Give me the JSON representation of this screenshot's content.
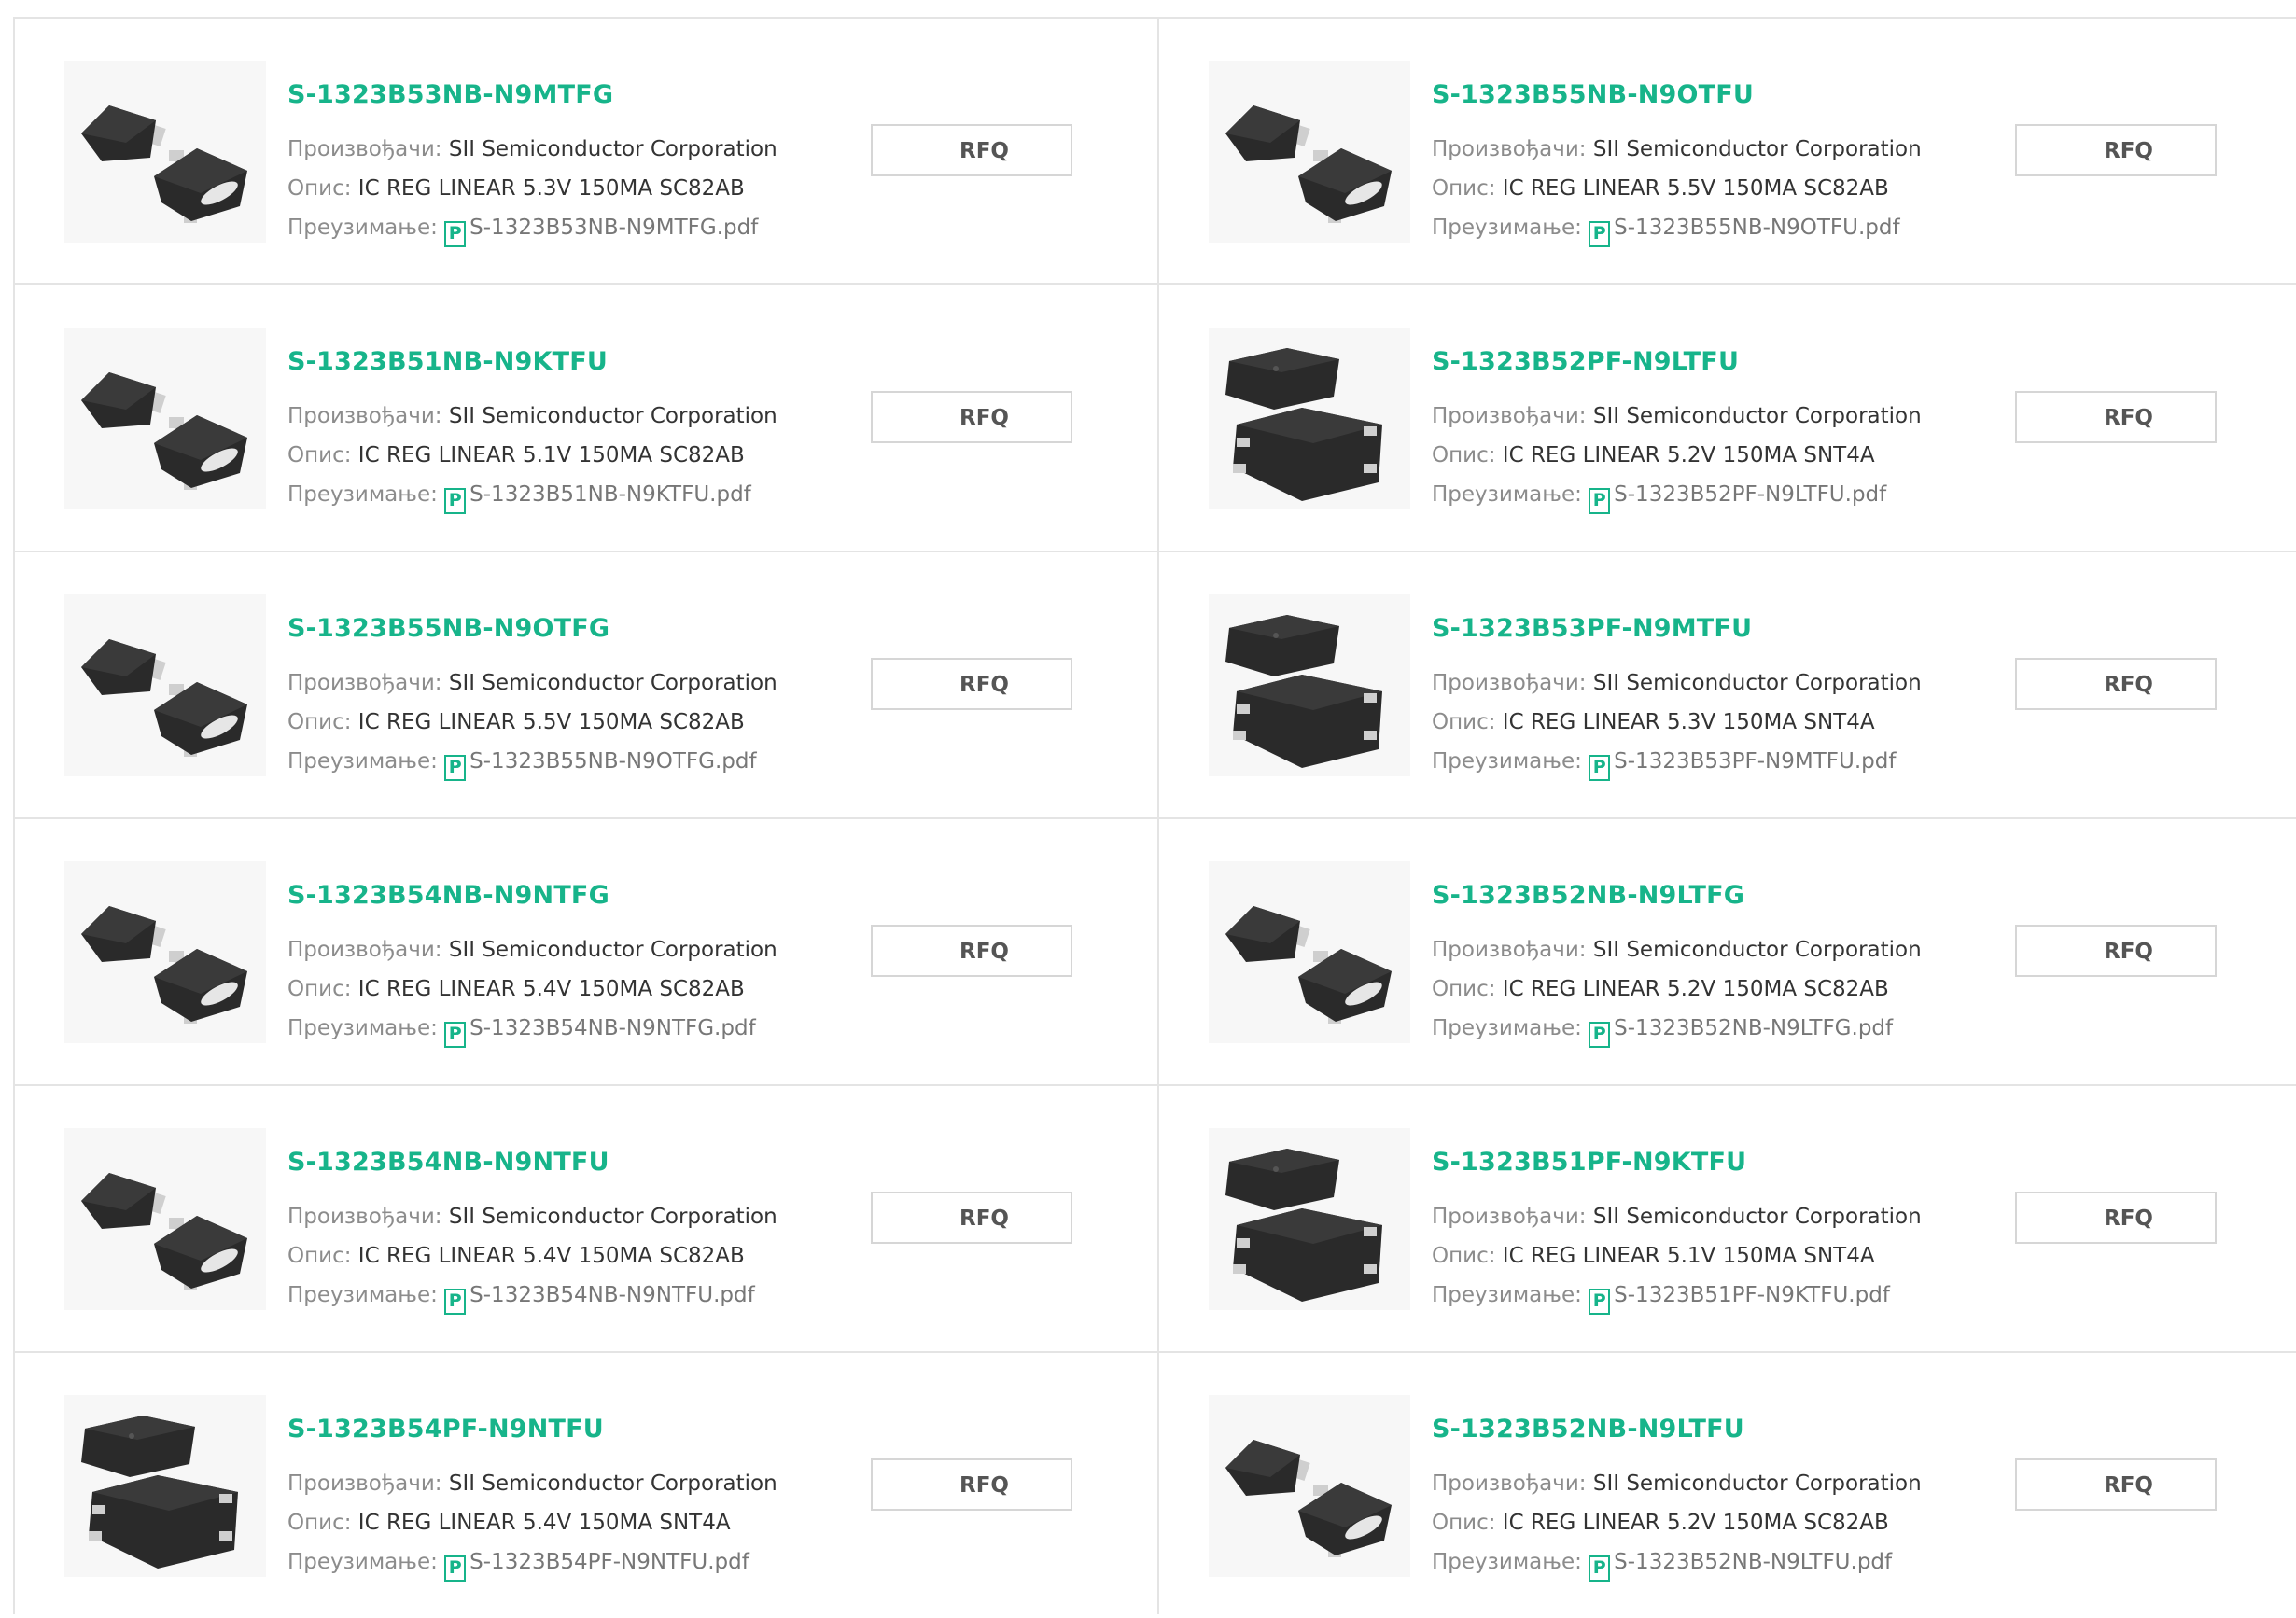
{
  "labels": {
    "manufacturer": "Произвођачи:",
    "description": "Опис:",
    "download": "Преузимање:",
    "rfq": "RFQ",
    "pdf_icon": "P"
  },
  "colors": {
    "accent": "#17b48a",
    "border": "#e4e4e4",
    "chip": "#2a2a2a",
    "pad": "#cfcfcf"
  },
  "products": [
    {
      "name": "S-1323B53NB-N9MTFG",
      "manufacturer": "SII Semiconductor Corporation",
      "description": "IC REG LINEAR 5.3V 150MA SC82AB",
      "pdf": "S-1323B53NB-N9MTFG.pdf",
      "package": "sc82ab"
    },
    {
      "name": "S-1323B55NB-N9OTFU",
      "manufacturer": "SII Semiconductor Corporation",
      "description": "IC REG LINEAR 5.5V 150MA SC82AB",
      "pdf": "S-1323B55NB-N9OTFU.pdf",
      "package": "sc82ab"
    },
    {
      "name": "S-1323B51NB-N9KTFU",
      "manufacturer": "SII Semiconductor Corporation",
      "description": "IC REG LINEAR 5.1V 150MA SC82AB",
      "pdf": "S-1323B51NB-N9KTFU.pdf",
      "package": "sc82ab"
    },
    {
      "name": "S-1323B52PF-N9LTFU",
      "manufacturer": "SII Semiconductor Corporation",
      "description": "IC REG LINEAR 5.2V 150MA SNT4A",
      "pdf": "S-1323B52PF-N9LTFU.pdf",
      "package": "snt4a"
    },
    {
      "name": "S-1323B55NB-N9OTFG",
      "manufacturer": "SII Semiconductor Corporation",
      "description": "IC REG LINEAR 5.5V 150MA SC82AB",
      "pdf": "S-1323B55NB-N9OTFG.pdf",
      "package": "sc82ab"
    },
    {
      "name": "S-1323B53PF-N9MTFU",
      "manufacturer": "SII Semiconductor Corporation",
      "description": "IC REG LINEAR 5.3V 150MA SNT4A",
      "pdf": "S-1323B53PF-N9MTFU.pdf",
      "package": "snt4a"
    },
    {
      "name": "S-1323B54NB-N9NTFG",
      "manufacturer": "SII Semiconductor Corporation",
      "description": "IC REG LINEAR 5.4V 150MA SC82AB",
      "pdf": "S-1323B54NB-N9NTFG.pdf",
      "package": "sc82ab"
    },
    {
      "name": "S-1323B52NB-N9LTFG",
      "manufacturer": "SII Semiconductor Corporation",
      "description": "IC REG LINEAR 5.2V 150MA SC82AB",
      "pdf": "S-1323B52NB-N9LTFG.pdf",
      "package": "sc82ab"
    },
    {
      "name": "S-1323B54NB-N9NTFU",
      "manufacturer": "SII Semiconductor Corporation",
      "description": "IC REG LINEAR 5.4V 150MA SC82AB",
      "pdf": "S-1323B54NB-N9NTFU.pdf",
      "package": "sc82ab"
    },
    {
      "name": "S-1323B51PF-N9KTFU",
      "manufacturer": "SII Semiconductor Corporation",
      "description": "IC REG LINEAR 5.1V 150MA SNT4A",
      "pdf": "S-1323B51PF-N9KTFU.pdf",
      "package": "snt4a"
    },
    {
      "name": "S-1323B54PF-N9NTFU",
      "manufacturer": "SII Semiconductor Corporation",
      "description": "IC REG LINEAR 5.4V 150MA SNT4A",
      "pdf": "S-1323B54PF-N9NTFU.pdf",
      "package": "snt4a"
    },
    {
      "name": "S-1323B52NB-N9LTFU",
      "manufacturer": "SII Semiconductor Corporation",
      "description": "IC REG LINEAR 5.2V 150MA SC82AB",
      "pdf": "S-1323B52NB-N9LTFU.pdf",
      "package": "sc82ab"
    }
  ]
}
